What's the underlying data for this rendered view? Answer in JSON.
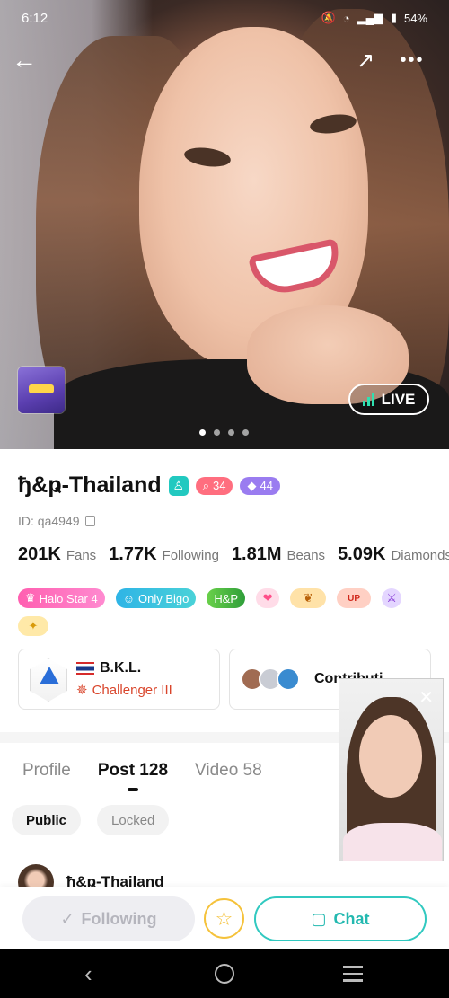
{
  "status_bar": {
    "time": "6:12",
    "battery": "54%"
  },
  "hero": {
    "live_label": "LIVE"
  },
  "profile": {
    "name": "ђ&ҏ-Thailand",
    "level_badge_1": "34",
    "level_badge_2": "44",
    "id_text": "ID: qa4949",
    "stats": [
      {
        "value": "201K",
        "label": "Fans"
      },
      {
        "value": "1.77K",
        "label": "Following"
      },
      {
        "value": "1.81M",
        "label": "Beans"
      },
      {
        "value": "5.09K",
        "label": "Diamonds"
      }
    ],
    "badges": [
      "Halo Star 4",
      "Only Bigo",
      "H&P"
    ],
    "family": {
      "name": "B.K.L.",
      "rank": "Challenger III"
    },
    "contribution_label": "Contributi..."
  },
  "tabs": [
    "Profile",
    "Post 128",
    "Video 58"
  ],
  "filters": [
    "Public",
    "Locked"
  ],
  "post": {
    "author": "ђ&ҏ-Thailand"
  },
  "bottom_bar": {
    "following_label": "Following",
    "chat_label": "Chat"
  },
  "colors": {
    "accent_teal": "#31c9c0",
    "star_gold": "#f5c23b",
    "live_bars": "#2fe0b0"
  }
}
